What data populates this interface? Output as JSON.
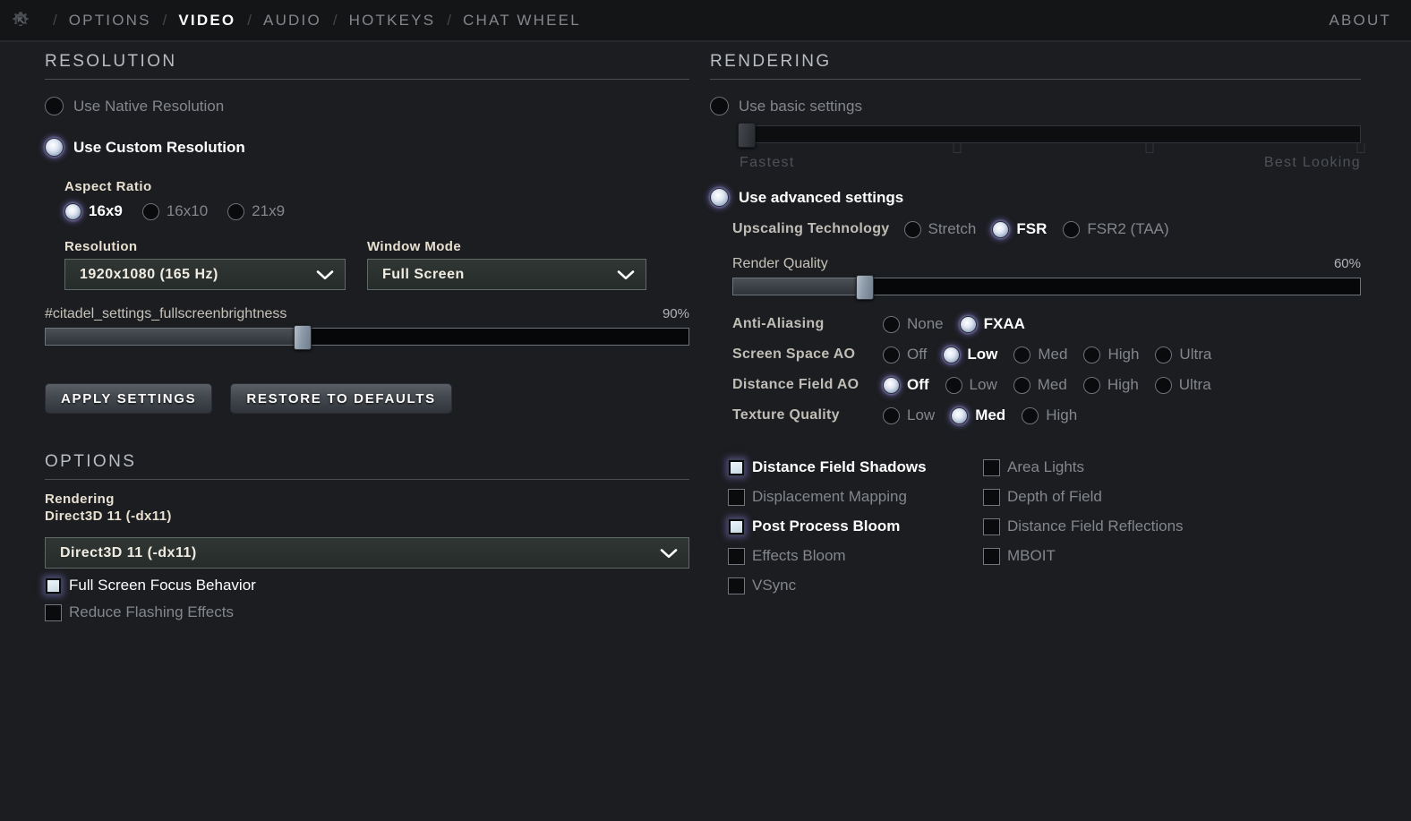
{
  "theme": {
    "bg": "#1b1d21",
    "nav_bg": "#141517",
    "accent_glow": "#8c82dc",
    "text_bright": "#ffffff",
    "text_dim": "#83868b",
    "rule": "#4a4d52"
  },
  "topnav": {
    "gear_icon": "gear-cursor-icon",
    "separator": "/",
    "tabs": [
      {
        "label": "OPTIONS",
        "active": false
      },
      {
        "label": "VIDEO",
        "active": true
      },
      {
        "label": "AUDIO",
        "active": false
      },
      {
        "label": "HOTKEYS",
        "active": false
      },
      {
        "label": "CHAT WHEEL",
        "active": false
      }
    ],
    "about_label": "ABOUT"
  },
  "resolution": {
    "title": "RESOLUTION",
    "mode_options": [
      {
        "label": "Use Native Resolution",
        "selected": false
      },
      {
        "label": "Use Custom Resolution",
        "selected": true
      }
    ],
    "aspect_ratio": {
      "label": "Aspect Ratio",
      "options": [
        {
          "label": "16x9",
          "selected": true
        },
        {
          "label": "16x10",
          "selected": false
        },
        {
          "label": "21x9",
          "selected": false
        }
      ]
    },
    "resolution_select": {
      "label": "Resolution",
      "value": "1920x1080 (165 Hz)",
      "chevron_icon": "chevron-down-icon"
    },
    "window_mode_select": {
      "label": "Window Mode",
      "value": "Full Screen",
      "chevron_icon": "chevron-down-icon"
    },
    "brightness_slider": {
      "label": "#citadel_settings_fullscreenbrightness",
      "value_label": "90%",
      "fill_percent": 40,
      "handle_percent": 40
    },
    "apply_button": "APPLY SETTINGS",
    "restore_button": "RESTORE TO DEFAULTS"
  },
  "options": {
    "title": "OPTIONS",
    "rendering_label": "Rendering",
    "rendering_value": "Direct3D 11 (-dx11)",
    "api_select": {
      "value": "Direct3D 11 (-dx11)",
      "chevron_icon": "chevron-down-icon"
    },
    "checkboxes": [
      {
        "label": "Full Screen Focus Behavior",
        "checked": true
      },
      {
        "label": "Reduce Flashing Effects",
        "checked": false
      }
    ]
  },
  "rendering": {
    "title": "RENDERING",
    "basic": {
      "label": "Use basic settings",
      "selected": false,
      "slider": {
        "handle_percent": 1,
        "ticks_percent": [
          35,
          66,
          100
        ],
        "left_label": "Fastest",
        "right_label": "Best Looking"
      }
    },
    "advanced": {
      "label": "Use advanced settings",
      "selected": true
    },
    "upscaling": {
      "label": "Upscaling Technology",
      "options": [
        {
          "label": "Stretch",
          "selected": false
        },
        {
          "label": "FSR",
          "selected": true
        },
        {
          "label": "FSR2 (TAA)",
          "selected": false
        }
      ]
    },
    "render_quality": {
      "label": "Render Quality",
      "value_label": "60%",
      "fill_percent": 21,
      "handle_percent": 21
    },
    "quality_rows": [
      {
        "label": "Anti-Aliasing",
        "options": [
          {
            "label": "None",
            "selected": false
          },
          {
            "label": "FXAA",
            "selected": true
          }
        ]
      },
      {
        "label": "Screen Space AO",
        "options": [
          {
            "label": "Off",
            "selected": false
          },
          {
            "label": "Low",
            "selected": true
          },
          {
            "label": "Med",
            "selected": false
          },
          {
            "label": "High",
            "selected": false
          },
          {
            "label": "Ultra",
            "selected": false
          }
        ]
      },
      {
        "label": "Distance Field AO",
        "options": [
          {
            "label": "Off",
            "selected": true
          },
          {
            "label": "Low",
            "selected": false
          },
          {
            "label": "Med",
            "selected": false
          },
          {
            "label": "High",
            "selected": false
          },
          {
            "label": "Ultra",
            "selected": false
          }
        ]
      },
      {
        "label": "Texture Quality",
        "options": [
          {
            "label": "Low",
            "selected": false
          },
          {
            "label": "Med",
            "selected": true
          },
          {
            "label": "High",
            "selected": false
          }
        ]
      }
    ],
    "toggles_col1": [
      {
        "label": "Distance Field Shadows",
        "checked": true
      },
      {
        "label": "Displacement Mapping",
        "checked": false
      },
      {
        "label": "Post Process Bloom",
        "checked": true
      },
      {
        "label": "Effects Bloom",
        "checked": false
      },
      {
        "label": "VSync",
        "checked": false
      }
    ],
    "toggles_col2": [
      {
        "label": "Area Lights",
        "checked": false
      },
      {
        "label": "Depth of Field",
        "checked": false
      },
      {
        "label": "Distance Field Reflections",
        "checked": false
      },
      {
        "label": "MBOIT",
        "checked": false
      }
    ]
  }
}
